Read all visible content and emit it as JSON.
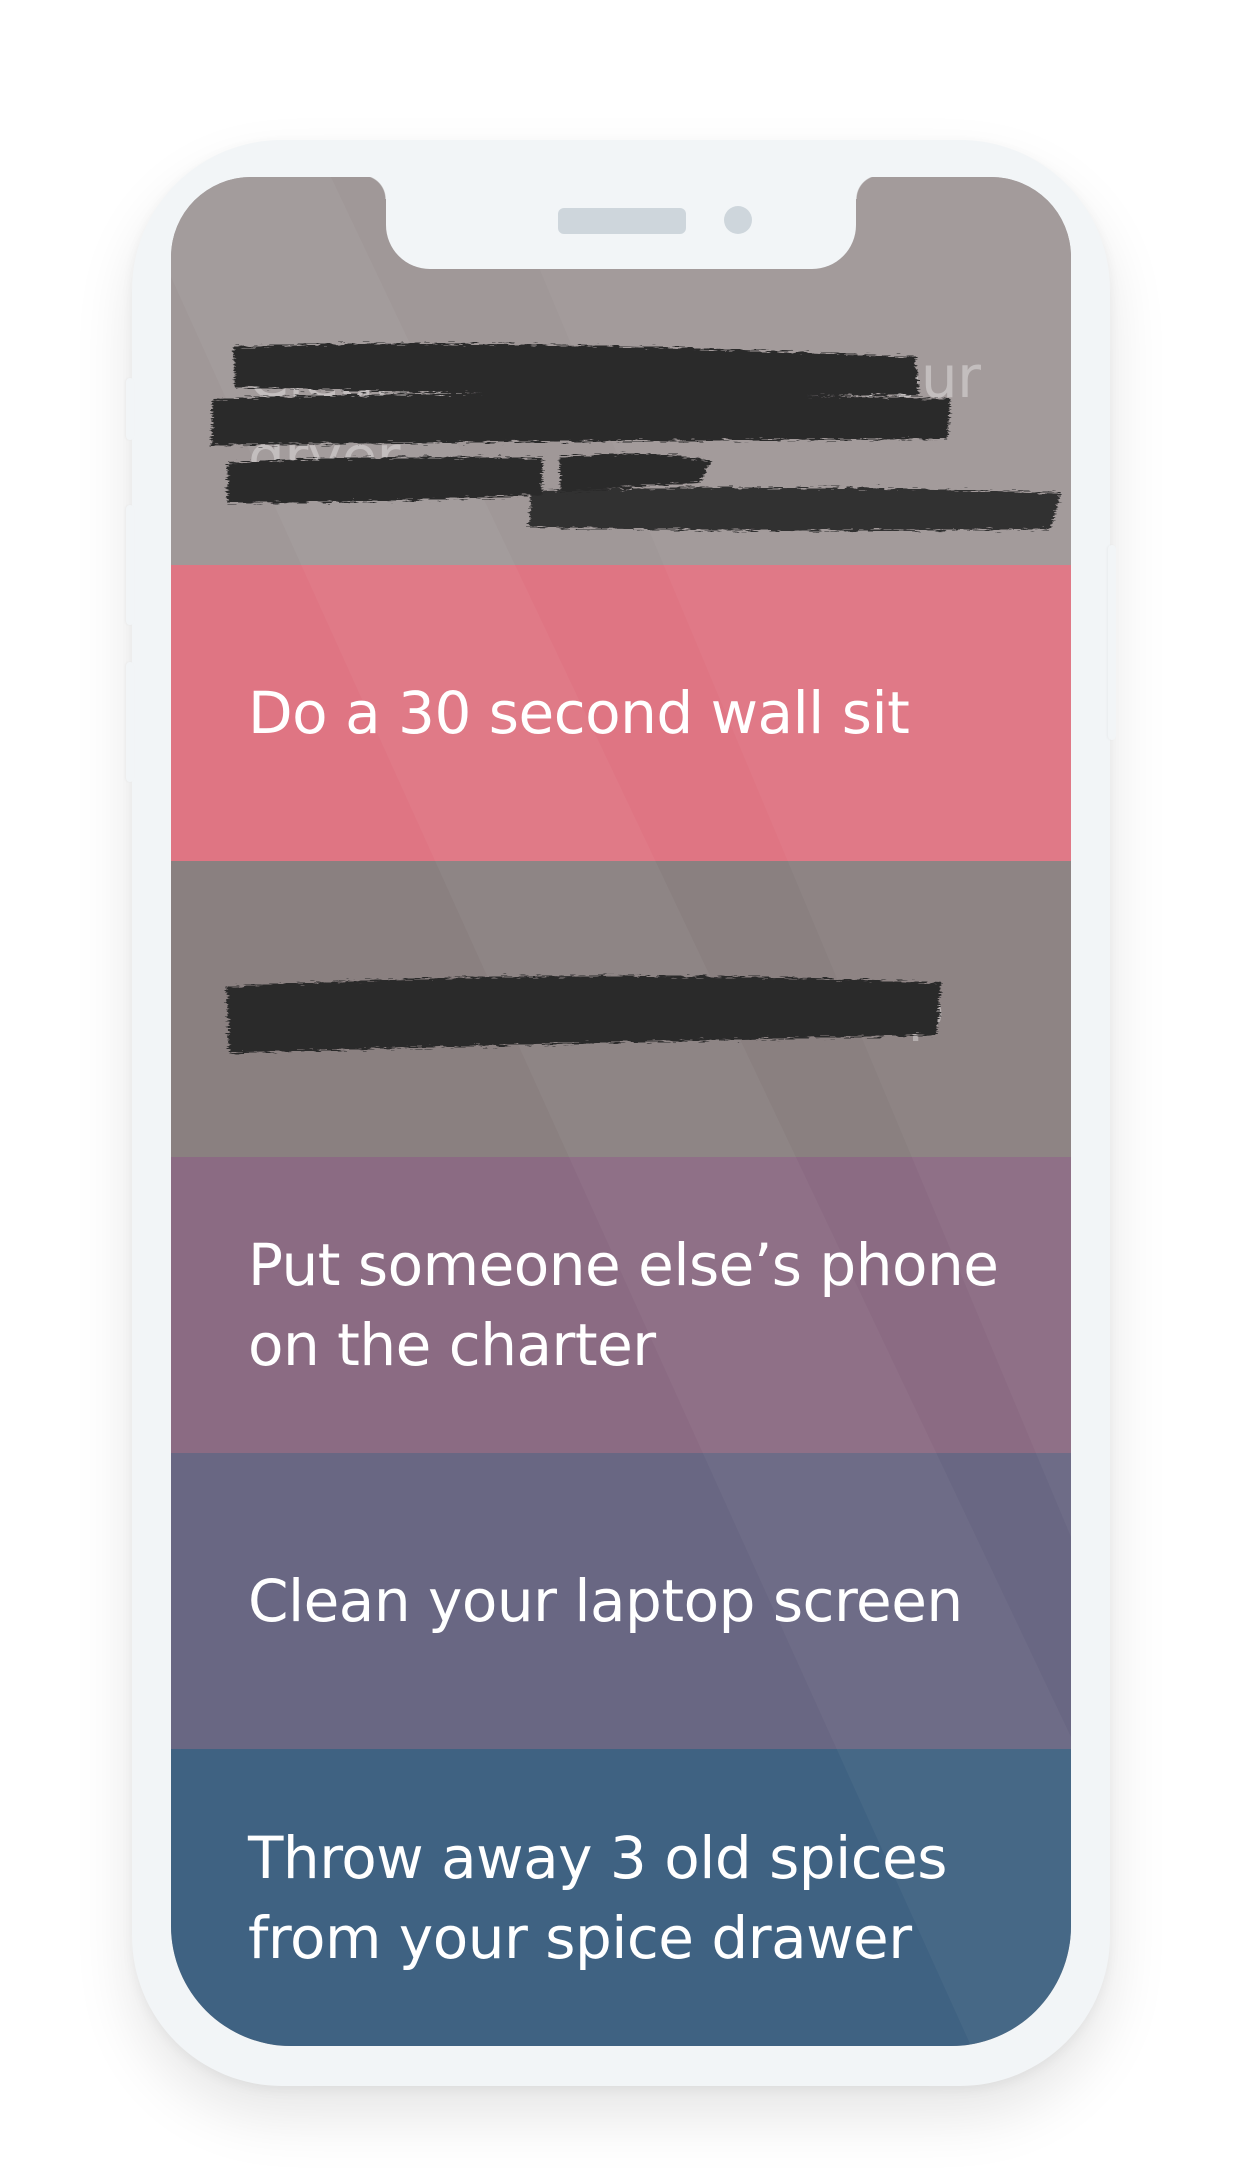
{
  "tasks": [
    {
      "label": "Clean the lint trap in your dryer",
      "color": "#a09898",
      "done": true
    },
    {
      "label": "Do a 30 second wall sit",
      "color": "#df7583",
      "done": false
    },
    {
      "label": "Don’t think about Trump",
      "color": "#8a8080",
      "done": true
    },
    {
      "label": "Put someone else’s phone on the charter",
      "color": "#8b6b83",
      "done": false
    },
    {
      "label": "Clean your laptop screen",
      "color": "#696783",
      "done": false
    },
    {
      "label": "Throw away 3 old spices from your spice drawer",
      "color": "#3f6282",
      "done": false
    }
  ],
  "icons": {
    "speaker": "speaker-grille-icon",
    "camera": "front-camera-icon"
  }
}
